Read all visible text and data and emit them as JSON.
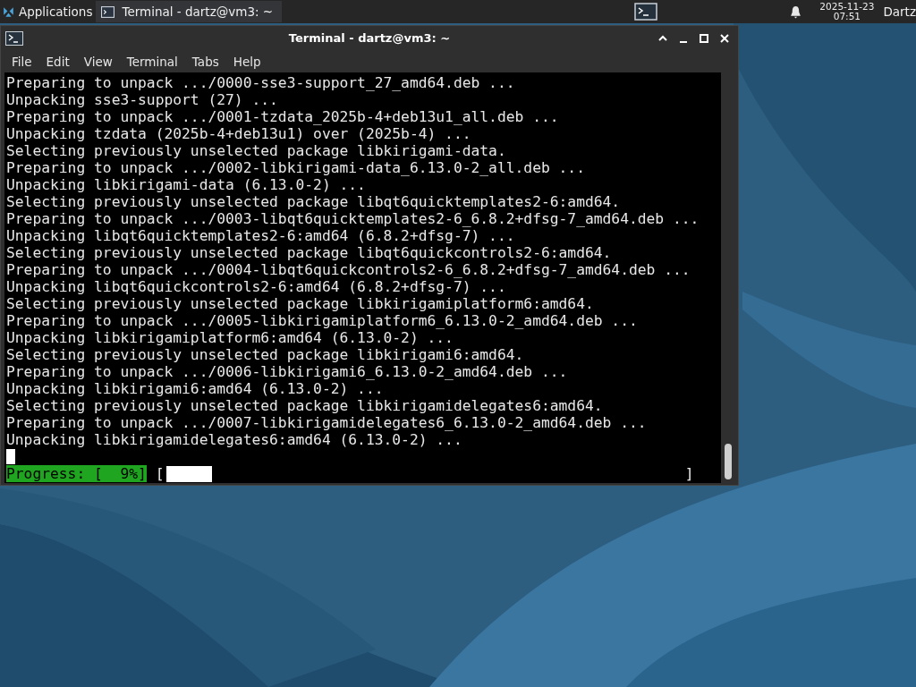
{
  "panel": {
    "apps_menu": "Applications",
    "tasks": [
      {
        "title": "Terminal - dartz@vm3: ~",
        "selected": true
      }
    ],
    "clock_date": "2025-11-23",
    "clock_time": "07:51",
    "user": "Dartz"
  },
  "window": {
    "title": "Terminal - dartz@vm3: ~"
  },
  "menu": [
    "File",
    "Edit",
    "View",
    "Terminal",
    "Tabs",
    "Help"
  ],
  "terminal": {
    "lines": [
      "Preparing to unpack .../0000-sse3-support_27_amd64.deb ...",
      "Unpacking sse3-support (27) ...",
      "Preparing to unpack .../0001-tzdata_2025b-4+deb13u1_all.deb ...",
      "Unpacking tzdata (2025b-4+deb13u1) over (2025b-4) ...",
      "Selecting previously unselected package libkirigami-data.",
      "Preparing to unpack .../0002-libkirigami-data_6.13.0-2_all.deb ...",
      "Unpacking libkirigami-data (6.13.0-2) ...",
      "Selecting previously unselected package libqt6quicktemplates2-6:amd64.",
      "Preparing to unpack .../0003-libqt6quicktemplates2-6_6.8.2+dfsg-7_amd64.deb ...",
      "Unpacking libqt6quicktemplates2-6:amd64 (6.8.2+dfsg-7) ...",
      "Selecting previously unselected package libqt6quickcontrols2-6:amd64.",
      "Preparing to unpack .../0004-libqt6quickcontrols2-6_6.8.2+dfsg-7_amd64.deb ...",
      "Unpacking libqt6quickcontrols2-6:amd64 (6.8.2+dfsg-7) ...",
      "Selecting previously unselected package libkirigamiplatform6:amd64.",
      "Preparing to unpack .../0005-libkirigamiplatform6_6.13.0-2_amd64.deb ...",
      "Unpacking libkirigamiplatform6:amd64 (6.13.0-2) ...",
      "Selecting previously unselected package libkirigami6:amd64.",
      "Preparing to unpack .../0006-libkirigami6_6.13.0-2_amd64.deb ...",
      "Unpacking libkirigami6:amd64 (6.13.0-2) ...",
      "Selecting previously unselected package libkirigamidelegates6:amd64.",
      "Preparing to unpack .../0007-libkirigamidelegates6_6.13.0-2_amd64.deb ...",
      "Unpacking libkirigamidelegates6:amd64 (6.13.0-2) ..."
    ],
    "progress": {
      "label": "Progress: [  9%]",
      "open": "[",
      "close": "]",
      "level": 0.09
    }
  }
}
